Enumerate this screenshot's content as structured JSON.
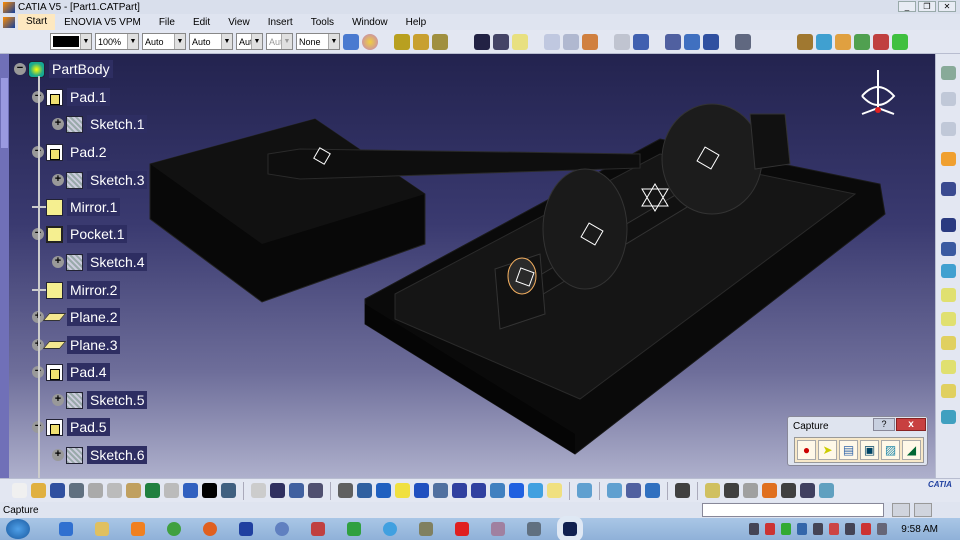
{
  "window": {
    "title": "CATIA V5 - [Part1.CATPart]"
  },
  "menu": [
    "Start",
    "ENOVIA V5 VPM",
    "File",
    "Edit",
    "View",
    "Insert",
    "Tools",
    "Window",
    "Help"
  ],
  "toolbar": {
    "color": "#000000",
    "zoom": "100%",
    "linetype": "Auto",
    "thickness": "Auto",
    "layer1": "Aut",
    "layer2": "Aut",
    "layer_none": "None"
  },
  "tree": [
    {
      "label": "PartBody",
      "icon": "body-icon",
      "level": 0,
      "exp": "-"
    },
    {
      "label": "Pad.1",
      "icon": "pad-icon",
      "level": 1,
      "exp": "-"
    },
    {
      "label": "Sketch.1",
      "icon": "sketch-icon",
      "level": 2,
      "exp": "+"
    },
    {
      "label": "Pad.2",
      "icon": "pad-icon",
      "level": 1,
      "exp": "-"
    },
    {
      "label": "Sketch.3",
      "icon": "sketch-icon",
      "level": 2,
      "exp": "+"
    },
    {
      "label": "Mirror.1",
      "icon": "mirror-icon",
      "level": 1,
      "exp": ""
    },
    {
      "label": "Pocket.1",
      "icon": "pocket-icon",
      "level": 1,
      "exp": "-"
    },
    {
      "label": "Sketch.4",
      "icon": "sketch-icon",
      "level": 2,
      "exp": "+"
    },
    {
      "label": "Mirror.2",
      "icon": "mirror-icon",
      "level": 1,
      "exp": ""
    },
    {
      "label": "Plane.2",
      "icon": "plane-icon",
      "level": 1,
      "exp": "+"
    },
    {
      "label": "Plane.3",
      "icon": "plane-icon",
      "level": 1,
      "exp": "+"
    },
    {
      "label": "Pad.4",
      "icon": "pad-icon",
      "level": 1,
      "exp": "-"
    },
    {
      "label": "Sketch.5",
      "icon": "sketch-icon",
      "level": 2,
      "exp": "+"
    },
    {
      "label": "Pad.5",
      "icon": "pad-icon",
      "level": 1,
      "exp": "-"
    },
    {
      "label": "Sketch.6",
      "icon": "sketch-icon",
      "level": 2,
      "exp": "+"
    }
  ],
  "capture": {
    "title": "Capture",
    "help": "?",
    "close": "x"
  },
  "status": {
    "text": "Capture"
  },
  "brand": {
    "logo": "CATIA"
  },
  "taskbar": {
    "clock": "9:58 AM"
  },
  "colors": {
    "viewport_top": "#23234f",
    "viewport_bottom": "#aeb0cc",
    "tree_label_bg": "#2e2e62"
  }
}
